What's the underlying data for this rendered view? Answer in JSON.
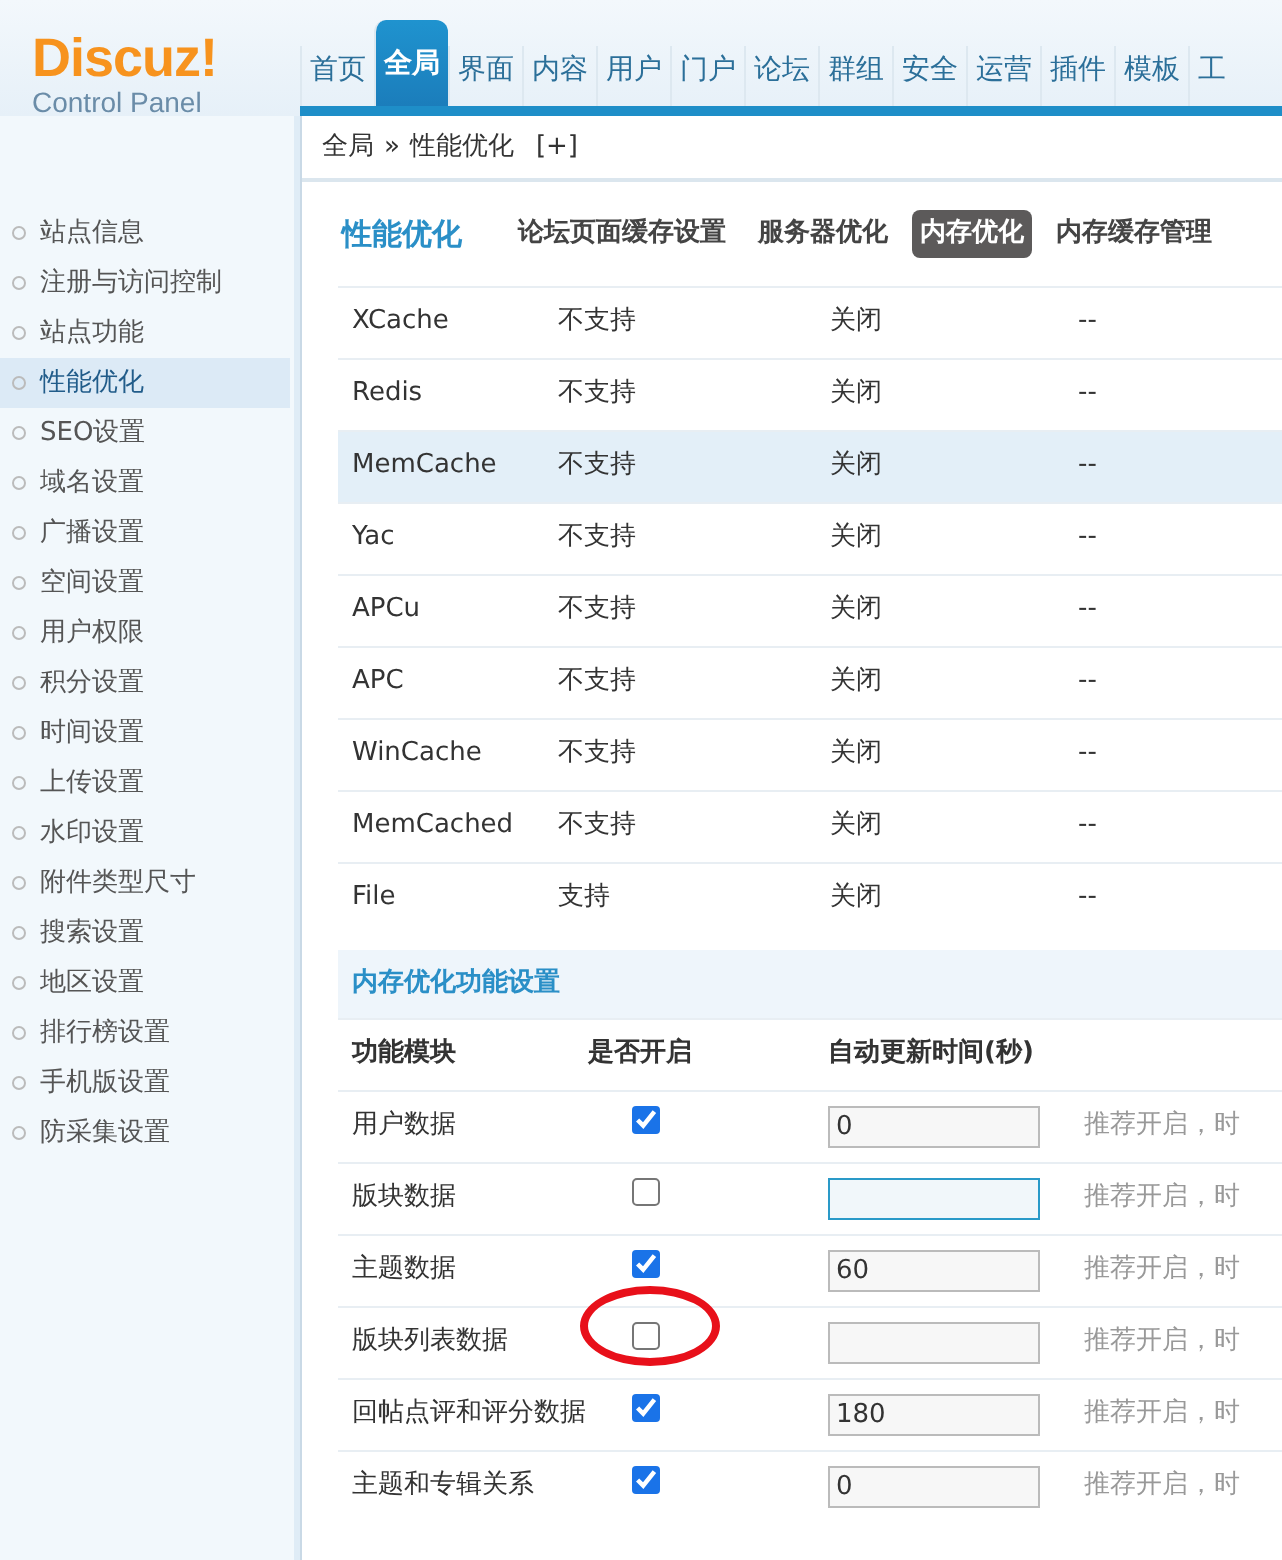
{
  "logo": {
    "title": "Discuz!",
    "subtitle": "Control Panel"
  },
  "nav_tabs": [
    {
      "label": "首页",
      "selected": false
    },
    {
      "label": "全局",
      "selected": true
    },
    {
      "label": "界面",
      "selected": false
    },
    {
      "label": "内容",
      "selected": false
    },
    {
      "label": "用户",
      "selected": false
    },
    {
      "label": "门户",
      "selected": false
    },
    {
      "label": "论坛",
      "selected": false
    },
    {
      "label": "群组",
      "selected": false
    },
    {
      "label": "安全",
      "selected": false
    },
    {
      "label": "运营",
      "selected": false
    },
    {
      "label": "插件",
      "selected": false
    },
    {
      "label": "模板",
      "selected": false
    },
    {
      "label": "工",
      "selected": false
    }
  ],
  "breadcrumb": {
    "root": "全局",
    "separator": "»",
    "current": "性能优化",
    "add": "[+]"
  },
  "sidebar": {
    "items": [
      {
        "label": "站点信息",
        "selected": false
      },
      {
        "label": "注册与访问控制",
        "selected": false
      },
      {
        "label": "站点功能",
        "selected": false
      },
      {
        "label": "性能优化",
        "selected": true
      },
      {
        "label": "SEO设置",
        "selected": false
      },
      {
        "label": "域名设置",
        "selected": false
      },
      {
        "label": "广播设置",
        "selected": false
      },
      {
        "label": "空间设置",
        "selected": false
      },
      {
        "label": "用户权限",
        "selected": false
      },
      {
        "label": "积分设置",
        "selected": false
      },
      {
        "label": "时间设置",
        "selected": false
      },
      {
        "label": "上传设置",
        "selected": false
      },
      {
        "label": "水印设置",
        "selected": false
      },
      {
        "label": "附件类型尺寸",
        "selected": false
      },
      {
        "label": "搜索设置",
        "selected": false
      },
      {
        "label": "地区设置",
        "selected": false
      },
      {
        "label": "排行榜设置",
        "selected": false
      },
      {
        "label": "手机版设置",
        "selected": false
      },
      {
        "label": "防采集设置",
        "selected": false
      }
    ]
  },
  "page_title": "性能优化",
  "sub_tabs": [
    {
      "label": "论坛页面缓存设置",
      "selected": false
    },
    {
      "label": "服务器优化",
      "selected": false
    },
    {
      "label": "内存优化",
      "selected": true
    },
    {
      "label": "内存缓存管理",
      "selected": false
    }
  ],
  "cache_table": {
    "rows": [
      {
        "name": "XCache",
        "support": "不支持",
        "status": "关闭",
        "column_4": "--",
        "highlighted": false
      },
      {
        "name": "Redis",
        "support": "不支持",
        "status": "关闭",
        "column_4": "--",
        "highlighted": false
      },
      {
        "name": "MemCache",
        "support": "不支持",
        "status": "关闭",
        "column_4": "--",
        "highlighted": true
      },
      {
        "name": "Yac",
        "support": "不支持",
        "status": "关闭",
        "column_4": "--",
        "highlighted": false
      },
      {
        "name": "APCu",
        "support": "不支持",
        "status": "关闭",
        "column_4": "--",
        "highlighted": false
      },
      {
        "name": "APC",
        "support": "不支持",
        "status": "关闭",
        "column_4": "--",
        "highlighted": false
      },
      {
        "name": "WinCache",
        "support": "不支持",
        "status": "关闭",
        "column_4": "--",
        "highlighted": false
      },
      {
        "name": "MemCached",
        "support": "不支持",
        "status": "关闭",
        "column_4": "--",
        "highlighted": false
      },
      {
        "name": "File",
        "support": "支持",
        "status": "关闭",
        "column_4": "--",
        "highlighted": false
      }
    ]
  },
  "memory_settings": {
    "title": "内存优化功能设置",
    "columns": [
      "功能模块",
      "是否开启",
      "自动更新时间(秒)"
    ],
    "rows": [
      {
        "module": "用户数据",
        "checked": true,
        "value": "0",
        "focused": false,
        "circled": false,
        "hint": "推荐开启，时"
      },
      {
        "module": "版块数据",
        "checked": false,
        "value": "",
        "focused": true,
        "circled": false,
        "hint": "推荐开启，时"
      },
      {
        "module": "主题数据",
        "checked": true,
        "value": "60",
        "focused": false,
        "circled": false,
        "hint": "推荐开启，时"
      },
      {
        "module": "版块列表数据",
        "checked": false,
        "value": "",
        "focused": false,
        "circled": true,
        "hint": "推荐开启，时"
      },
      {
        "module": "回帖点评和评分数据",
        "checked": true,
        "value": "180",
        "focused": false,
        "circled": false,
        "hint": "推荐开启，时"
      },
      {
        "module": "主题和专辑关系",
        "checked": true,
        "value": "0",
        "focused": false,
        "circled": false,
        "hint": "推荐开启，时"
      }
    ]
  }
}
